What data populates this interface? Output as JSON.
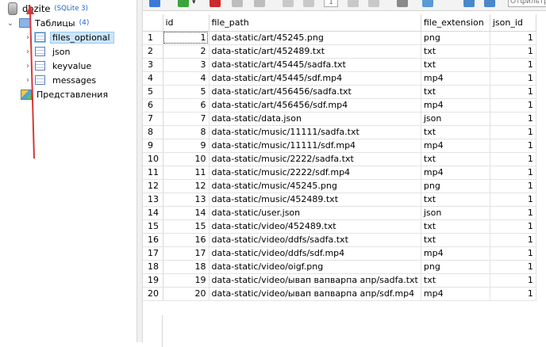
{
  "tree": {
    "database": {
      "name": "dbzite",
      "engine": "(SQLite 3)"
    },
    "tables_folder": {
      "label": "Таблицы",
      "count": "(4)"
    },
    "tables": [
      {
        "label": "files_optional",
        "selected": true
      },
      {
        "label": "json",
        "selected": false
      },
      {
        "label": "keyvalue",
        "selected": false
      },
      {
        "label": "messages",
        "selected": false
      }
    ],
    "views_label": "Представления"
  },
  "toolbar": {
    "page_value": "1",
    "filter_placeholder": "Отфильтро..."
  },
  "grid": {
    "columns": [
      "id",
      "file_path",
      "file_extension",
      "json_id"
    ],
    "rows": [
      [
        "1",
        "data-static/art/45245.png",
        "png",
        "1"
      ],
      [
        "2",
        "data-static/art/452489.txt",
        "txt",
        "1"
      ],
      [
        "3",
        "data-static/art/45445/sadfa.txt",
        "txt",
        "1"
      ],
      [
        "4",
        "data-static/art/45445/sdf.mp4",
        "mp4",
        "1"
      ],
      [
        "5",
        "data-static/art/456456/sadfa.txt",
        "txt",
        "1"
      ],
      [
        "6",
        "data-static/art/456456/sdf.mp4",
        "mp4",
        "1"
      ],
      [
        "7",
        "data-static/data.json",
        "json",
        "1"
      ],
      [
        "8",
        "data-static/music/11111/sadfa.txt",
        "txt",
        "1"
      ],
      [
        "9",
        "data-static/music/11111/sdf.mp4",
        "mp4",
        "1"
      ],
      [
        "10",
        "data-static/music/2222/sadfa.txt",
        "txt",
        "1"
      ],
      [
        "11",
        "data-static/music/2222/sdf.mp4",
        "mp4",
        "1"
      ],
      [
        "12",
        "data-static/music/45245.png",
        "png",
        "1"
      ],
      [
        "13",
        "data-static/music/452489.txt",
        "txt",
        "1"
      ],
      [
        "14",
        "data-static/user.json",
        "json",
        "1"
      ],
      [
        "15",
        "data-static/video/452489.txt",
        "txt",
        "1"
      ],
      [
        "16",
        "data-static/video/ddfs/sadfa.txt",
        "txt",
        "1"
      ],
      [
        "17",
        "data-static/video/ddfs/sdf.mp4",
        "mp4",
        "1"
      ],
      [
        "18",
        "data-static/video/oigf.png",
        "png",
        "1"
      ],
      [
        "19",
        "data-static/video/ывап вапварпа апр/sadfa.txt",
        "txt",
        "1"
      ],
      [
        "20",
        "data-static/video/ывап вапварпа апр/sdf.mp4",
        "mp4",
        "1"
      ]
    ]
  },
  "colors": {
    "selection": "#cce6fb",
    "accent_blue": "#2266cc",
    "arrow_red": "#d93636"
  }
}
